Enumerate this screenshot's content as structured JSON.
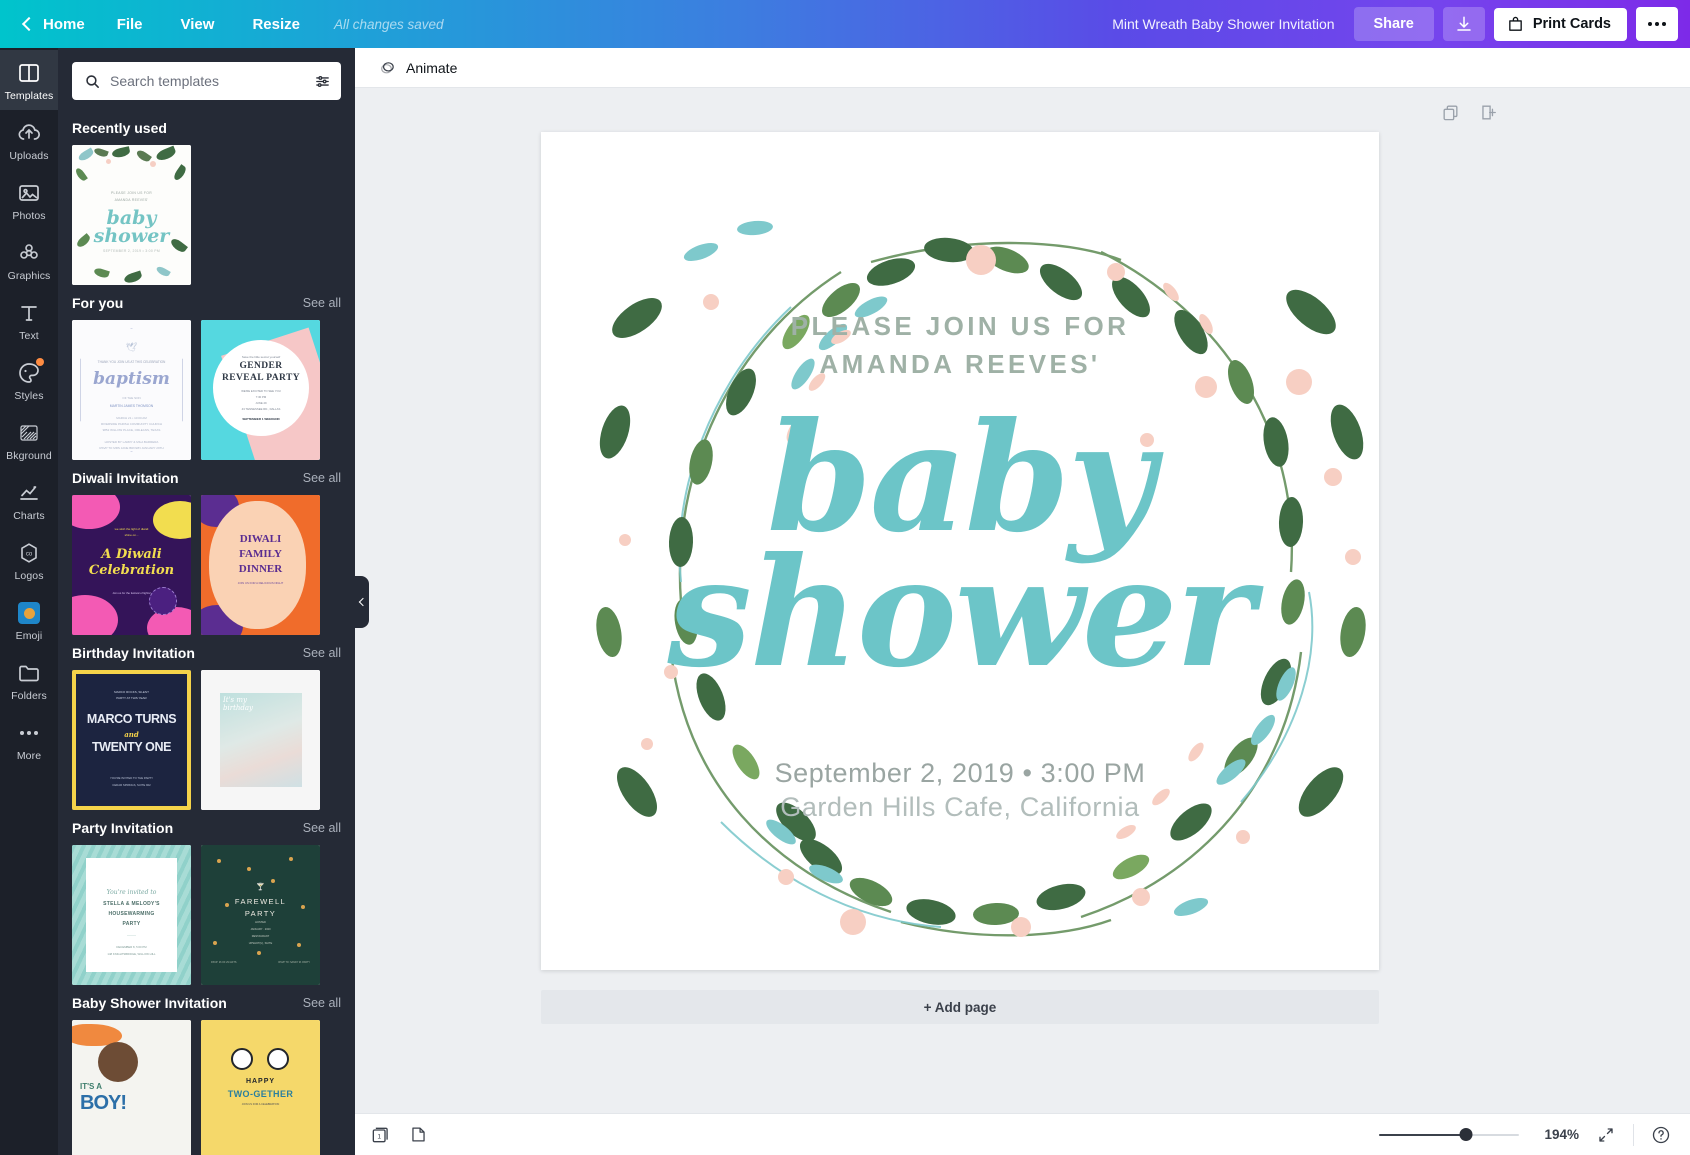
{
  "topbar": {
    "home_label": "Home",
    "menu": [
      "File",
      "View",
      "Resize"
    ],
    "save_status": "All changes saved",
    "doc_title": "Mint Wreath Baby Shower Invitation",
    "share_label": "Share",
    "print_label": "Print Cards",
    "download_icon": "download-icon",
    "more_icon": "more-horizontal-icon"
  },
  "rail": {
    "items": [
      {
        "label": "Templates",
        "icon": "templates-icon",
        "active": true,
        "badge": false
      },
      {
        "label": "Uploads",
        "icon": "upload-cloud-icon",
        "active": false,
        "badge": false
      },
      {
        "label": "Photos",
        "icon": "photo-icon",
        "active": false,
        "badge": false
      },
      {
        "label": "Graphics",
        "icon": "graphics-icon",
        "active": false,
        "badge": false
      },
      {
        "label": "Text",
        "icon": "text-icon",
        "active": false,
        "badge": false
      },
      {
        "label": "Styles",
        "icon": "styles-palette-icon",
        "active": false,
        "badge": true
      },
      {
        "label": "Bkground",
        "icon": "background-icon",
        "active": false,
        "badge": false
      },
      {
        "label": "Charts",
        "icon": "chart-line-icon",
        "active": false,
        "badge": false
      },
      {
        "label": "Logos",
        "icon": "logos-icon",
        "active": false,
        "badge": false
      },
      {
        "label": "Emoji",
        "icon": "emoji-icon",
        "active": false,
        "badge": false
      },
      {
        "label": "Folders",
        "icon": "folder-icon",
        "active": false,
        "badge": false
      },
      {
        "label": "More",
        "icon": "more-dots-icon",
        "active": false,
        "badge": false
      }
    ]
  },
  "panel": {
    "search": {
      "placeholder": "Search templates",
      "value": "",
      "search_icon": "search-icon",
      "filter_icon": "filter-sliders-icon"
    },
    "see_all_label": "See all",
    "sections": [
      {
        "title": "Recently used",
        "show_see_all": false,
        "thumbs": [
          {
            "kind": "wreath",
            "name": "mint-wreath-baby-shower",
            "line1": "PLEASE JOIN US FOR",
            "line2": "AMANDA REEVES'",
            "script1": "baby",
            "script2": "shower"
          }
        ]
      },
      {
        "title": "For you",
        "show_see_all": true,
        "thumbs": [
          {
            "kind": "baptism",
            "name": "baptism-template",
            "script1": "baptism",
            "line1": "THANK YOU JOIN US AT THIS CELEBRATION"
          },
          {
            "kind": "gender",
            "name": "gender-reveal-party-template",
            "title1": "GENDER",
            "title2": "REVEAL PARTY",
            "sub": "Save the little secret yourself",
            "footer": "SEPTEMBER 1 WEEKEND"
          }
        ]
      },
      {
        "title": "Diwali Invitation",
        "show_see_all": true,
        "thumbs": [
          {
            "kind": "diwali1",
            "name": "diwali-celebration-template",
            "script1": "A Diwali",
            "script2": "Celebration",
            "sub": "Join us for the festival of lights!"
          },
          {
            "kind": "diwali2",
            "name": "diwali-family-dinner-template",
            "title1": "DIWALI",
            "title2": "FAMILY",
            "title3": "DINNER",
            "sub": "JOIN US FOR A DELICIOUS NIGHT"
          }
        ]
      },
      {
        "title": "Birthday Invitation",
        "show_see_all": true,
        "thumbs": [
          {
            "kind": "marco",
            "name": "marco-turns-twenty-one-template",
            "title1": "MARCO TURNS",
            "mid": "and",
            "title2": "TWENTY ONE",
            "sub": "YOU'RE INVITED TO THE PARTY"
          },
          {
            "kind": "bday2",
            "name": "its-my-birthday-template",
            "line1": "It's my",
            "line2": "birthday"
          }
        ]
      },
      {
        "title": "Party Invitation",
        "show_see_all": true,
        "thumbs": [
          {
            "kind": "house",
            "name": "housewarming-party-template",
            "script1": "You're invited to",
            "title1": "STELLA & MELODY'S",
            "title2": "HOUSEWARMING",
            "title3": "PARTY"
          },
          {
            "kind": "farewell",
            "name": "farewell-party-template",
            "title1": "FAREWELL",
            "title2": "PARTY",
            "sub": "HOSTED BY JANUARY 2020"
          }
        ]
      },
      {
        "title": "Baby Shower Invitation",
        "show_see_all": true,
        "thumbs": [
          {
            "kind": "boy",
            "name": "its-a-boy-template",
            "title1": "IT'S A",
            "title2": "BOY!"
          },
          {
            "kind": "panda",
            "name": "happy-two-gether-template",
            "title1": "HAPPY",
            "title2": "TWO-GETHER",
            "sub": "JOIN US FOR A CELEBRATION"
          }
        ]
      }
    ]
  },
  "context_bar": {
    "animate_label": "Animate",
    "animate_icon": "animate-icon"
  },
  "canvas_tools": {
    "duplicate_icon": "duplicate-page-icon",
    "export_icon": "export-page-icon"
  },
  "design": {
    "header_line1": "PLEASE JOIN US FOR",
    "header_line2": "AMANDA REEVES'",
    "script_line1": "baby",
    "script_line2": "shower",
    "when": "September 2, 2019  •  3:00 PM",
    "where": "Garden Hills Cafe, California",
    "colors": {
      "script": "#6cc5c8",
      "header": "#9fb1a6",
      "body": "#9aa5a2",
      "leaf_dark": "#3f6b43",
      "leaf_mid": "#5c8a52",
      "leaf_teal": "#7ec9cc",
      "petal": "#f7cfc3"
    }
  },
  "add_page": {
    "label": "+ Add page"
  },
  "bottombar": {
    "page_count_badge": "1",
    "page_icon": "page-stack-icon",
    "notes_icon": "notes-icon",
    "zoom_value": "194%",
    "fullscreen_icon": "expand-icon",
    "help_icon": "help-circle-icon"
  }
}
